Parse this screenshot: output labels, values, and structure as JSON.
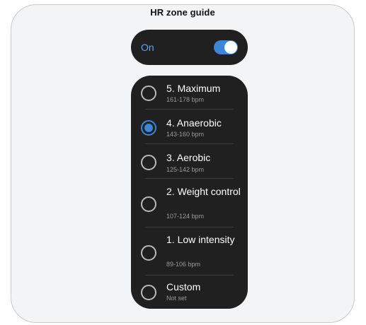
{
  "header": {
    "title": "HR zone guide"
  },
  "toggle": {
    "label": "On",
    "state": "on",
    "accent_color": "#3b86d6"
  },
  "zones": [
    {
      "title": "5. Maximum",
      "subtitle": "161-178 bpm",
      "selected": false
    },
    {
      "title": "4. Anaerobic",
      "subtitle": "143-160 bpm",
      "selected": true
    },
    {
      "title": "3. Aerobic",
      "subtitle": "125-142 bpm",
      "selected": false
    },
    {
      "title": "2. Weight control",
      "subtitle": "107-124 bpm",
      "selected": false
    },
    {
      "title": "1. Low intensity",
      "subtitle": "89-106 bpm",
      "selected": false
    },
    {
      "title": "Custom",
      "subtitle": "Not set",
      "selected": false
    }
  ]
}
